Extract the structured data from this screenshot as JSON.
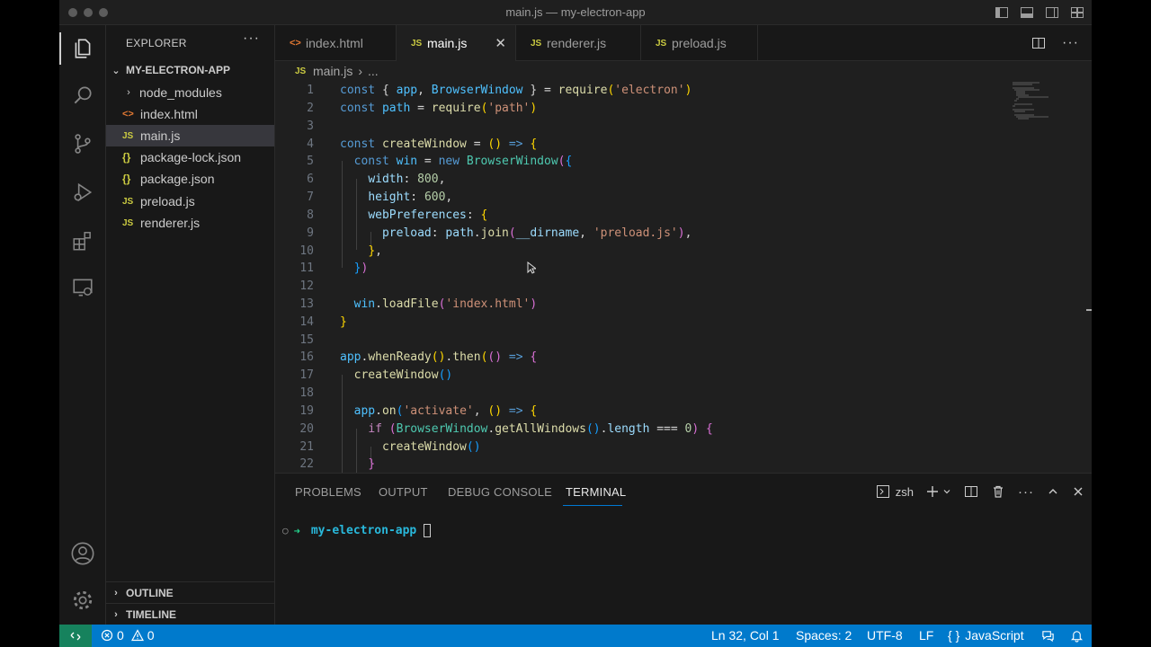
{
  "window": {
    "title": "main.js — my-electron-app"
  },
  "sidebar": {
    "title": "EXPLORER",
    "more": "···",
    "folder": "MY-ELECTRON-APP",
    "items": [
      {
        "icon": "›",
        "label": "node_modules"
      },
      {
        "icon": "<>",
        "label": "index.html"
      },
      {
        "icon": "JS",
        "label": "main.js"
      },
      {
        "icon": "{}",
        "label": "package-lock.json"
      },
      {
        "icon": "{}",
        "label": "package.json"
      },
      {
        "icon": "JS",
        "label": "preload.js"
      },
      {
        "icon": "JS",
        "label": "renderer.js"
      }
    ],
    "outline": "OUTLINE",
    "timeline": "TIMELINE"
  },
  "tabs": [
    {
      "icon": "<>",
      "label": "index.html"
    },
    {
      "icon": "JS",
      "label": "main.js",
      "close": "✕"
    },
    {
      "icon": "JS",
      "label": "renderer.js"
    },
    {
      "icon": "JS",
      "label": "preload.js"
    }
  ],
  "breadcrumb": {
    "icon": "JS",
    "file": "main.js",
    "sep": "›",
    "rest": "..."
  },
  "editor": {
    "line_numbers": [
      "1",
      "2",
      "3",
      "4",
      "5",
      "6",
      "7",
      "8",
      "9",
      "10",
      "11",
      "12",
      "13",
      "14",
      "15",
      "16",
      "17",
      "18",
      "19",
      "20",
      "21",
      "22"
    ],
    "code": {
      "l1_kw": "const",
      "l1_a": " { ",
      "l1_b": "app",
      "l1_c": ", ",
      "l1_d": "BrowserWindow",
      "l1_e": " } = ",
      "l1_f": "require",
      "l1_g": "(",
      "l1_h": "'electron'",
      "l1_i": ")",
      "l2_kw": "const",
      "l2_a": " ",
      "l2_b": "path",
      "l2_c": " = ",
      "l2_d": "require",
      "l2_e": "(",
      "l2_f": "'path'",
      "l2_g": ")",
      "l4_kw": "const",
      "l4_a": " ",
      "l4_b": "createWindow",
      "l4_c": " = ",
      "l4_d": "()",
      "l4_e": " ",
      "l4_f": "=>",
      "l4_g": " ",
      "l4_h": "{",
      "l5_a": "  ",
      "l5_kw": "const",
      "l5_b": " ",
      "l5_c": "win",
      "l5_d": " = ",
      "l5_e": "new",
      "l5_f": " ",
      "l5_g": "BrowserWindow",
      "l5_h": "(",
      "l5_i": "{",
      "l6_a": "    ",
      "l6_b": "width",
      "l6_c": ": ",
      "l6_d": "800",
      "l6_e": ",",
      "l7_a": "    ",
      "l7_b": "height",
      "l7_c": ": ",
      "l7_d": "600",
      "l7_e": ",",
      "l8_a": "    ",
      "l8_b": "webPreferences",
      "l8_c": ": ",
      "l8_d": "{",
      "l9_a": "      ",
      "l9_b": "preload",
      "l9_c": ": ",
      "l9_d": "path",
      "l9_e": ".",
      "l9_f": "join",
      "l9_g": "(",
      "l9_h": "__dirname",
      "l9_i": ", ",
      "l9_j": "'preload.js'",
      "l9_k": ")",
      "l9_l": ",",
      "l10_a": "    ",
      "l10_b": "}",
      "l10_c": ",",
      "l11_a": "  ",
      "l11_b": "}",
      "l11_c": ")",
      "l13_a": "  ",
      "l13_b": "win",
      "l13_c": ".",
      "l13_d": "loadFile",
      "l13_e": "(",
      "l13_f": "'index.html'",
      "l13_g": ")",
      "l14_a": "}",
      "l16_a": "app",
      "l16_b": ".",
      "l16_c": "whenReady",
      "l16_d": "()",
      "l16_e": ".",
      "l16_f": "then",
      "l16_g": "(",
      "l16_h": "()",
      "l16_i": " ",
      "l16_j": "=>",
      "l16_k": " ",
      "l16_l": "{",
      "l17_a": "  ",
      "l17_b": "createWindow",
      "l17_c": "()",
      "l19_a": "  ",
      "l19_b": "app",
      "l19_c": ".",
      "l19_d": "on",
      "l19_e": "(",
      "l19_f": "'activate'",
      "l19_g": ", ",
      "l19_h": "()",
      "l19_i": " ",
      "l19_j": "=>",
      "l19_k": " ",
      "l19_l": "{",
      "l20_a": "    ",
      "l20_b": "if",
      "l20_c": " ",
      "l20_d": "(",
      "l20_e": "BrowserWindow",
      "l20_f": ".",
      "l20_g": "getAllWindows",
      "l20_h": "()",
      "l20_i": ".",
      "l20_j": "length",
      "l20_k": " === ",
      "l20_l": "0",
      "l20_m": ")",
      "l20_n": " ",
      "l20_o": "{",
      "l21_a": "      ",
      "l21_b": "createWindow",
      "l21_c": "()",
      "l22_a": "    ",
      "l22_b": "}"
    }
  },
  "panel": {
    "tabs": [
      "PROBLEMS",
      "OUTPUT",
      "DEBUG CONSOLE",
      "TERMINAL"
    ],
    "shell": "zsh",
    "terminal": {
      "dot": "○",
      "arrow": "➜",
      "dir": "my-electron-app"
    }
  },
  "statusbar": {
    "errors": "0",
    "warnings": "0",
    "position": "Ln 32, Col 1",
    "spaces": "Spaces: 2",
    "encoding": "UTF-8",
    "eol": "LF",
    "language_icon": "{ }",
    "language": "JavaScript"
  },
  "colors": {
    "accent": "#007acc",
    "remote": "#16825d",
    "tab_underline": "#0078d4"
  }
}
